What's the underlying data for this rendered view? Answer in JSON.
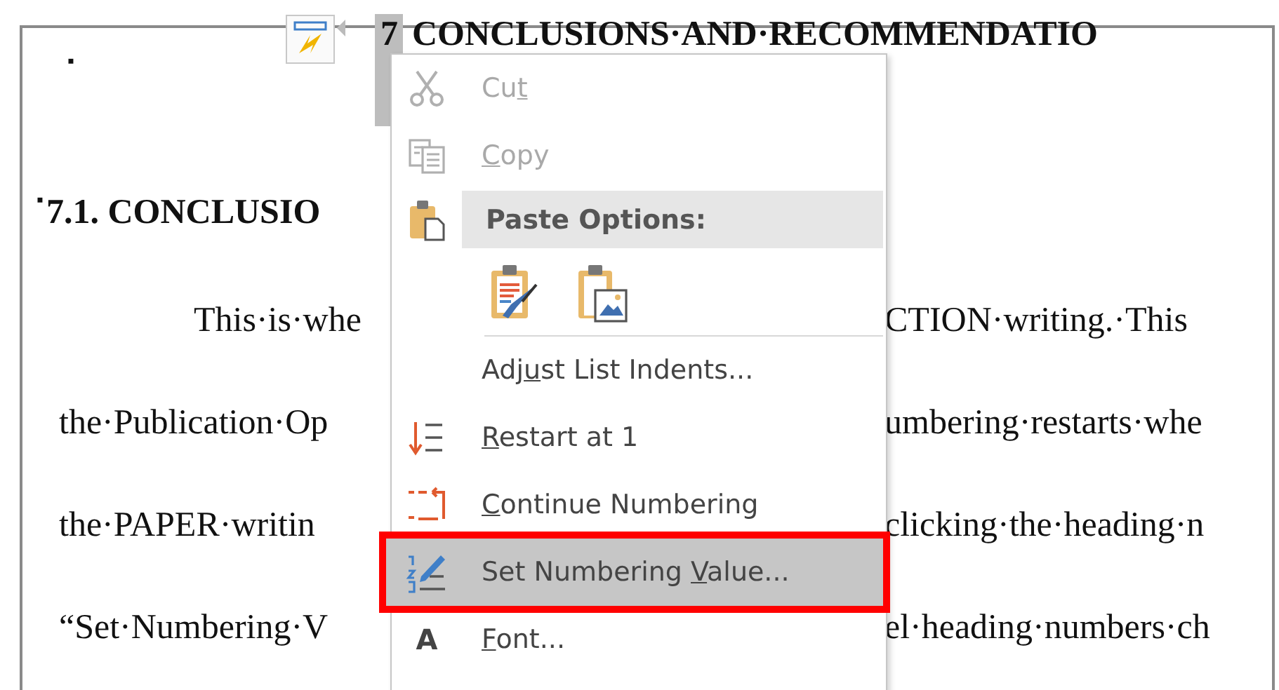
{
  "document": {
    "heading": {
      "bullet": "▪",
      "number": "7",
      "title": "CONCLUSIONS·AND·RECOMMENDATIO"
    },
    "subheading": {
      "bullet": "▪",
      "text": "7.1. CONCLUSIO"
    },
    "lines": [
      {
        "left": "This·is·whe",
        "right": "CTION·writing.·This",
        "indent": true
      },
      {
        "left": "the·Publication·Op",
        "right": "umbering·restarts·whe",
        "indent": false
      },
      {
        "left": "the·PAPER·writin",
        "right": "clicking·the·heading·n",
        "indent": false
      },
      {
        "left": "“Set·Numbering·V",
        "right": "el·heading·numbers·ch",
        "indent": false
      }
    ]
  },
  "context_menu": {
    "items": [
      {
        "kind": "command",
        "label": {
          "before": "Cu",
          "key": "t"
        },
        "disabled": true,
        "highlighted": false
      },
      {
        "kind": "command",
        "label": {
          "key": "C",
          "after": "opy"
        },
        "disabled": true,
        "highlighted": false
      },
      {
        "kind": "header",
        "label": "Paste Options:"
      },
      {
        "kind": "command",
        "label": {
          "before": "Adj",
          "key": "u",
          "after": "st List Indents..."
        },
        "disabled": false,
        "highlighted": false
      },
      {
        "kind": "command",
        "label": {
          "key": "R",
          "after": "estart at 1"
        },
        "disabled": false,
        "highlighted": false
      },
      {
        "kind": "command",
        "label": {
          "key": "C",
          "after": "ontinue Numbering"
        },
        "disabled": false,
        "highlighted": false
      },
      {
        "kind": "command",
        "label": {
          "before": "Set Numbering ",
          "key": "V",
          "after": "alue..."
        },
        "disabled": false,
        "highlighted": true
      },
      {
        "kind": "command",
        "label": {
          "key": "F",
          "after": "ont..."
        },
        "disabled": false,
        "highlighted": false,
        "icon_glyph": "A"
      }
    ]
  }
}
